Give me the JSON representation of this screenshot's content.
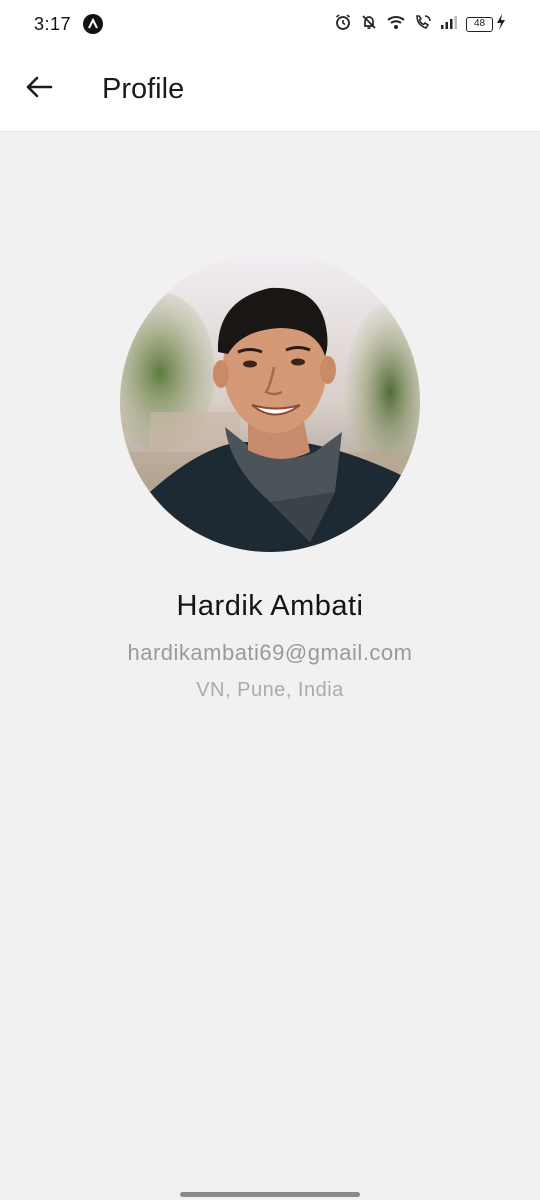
{
  "status_bar": {
    "time": "3:17",
    "battery_level": "48",
    "icons": [
      "app-notification-icon",
      "alarm-icon",
      "mute-icon",
      "wifi-icon",
      "wifi-calling-icon",
      "signal-icon",
      "battery-icon",
      "charging-icon"
    ]
  },
  "app_bar": {
    "title": "Profile",
    "back_icon": "arrow-left-icon"
  },
  "profile": {
    "name": "Hardik Ambati",
    "email": "hardikambati69@gmail.com",
    "location": "VN, Pune, India"
  },
  "colors": {
    "background": "#f1f1f1",
    "app_bar": "#ffffff",
    "name_text": "#151515",
    "secondary_text": "#9a9a9a"
  }
}
